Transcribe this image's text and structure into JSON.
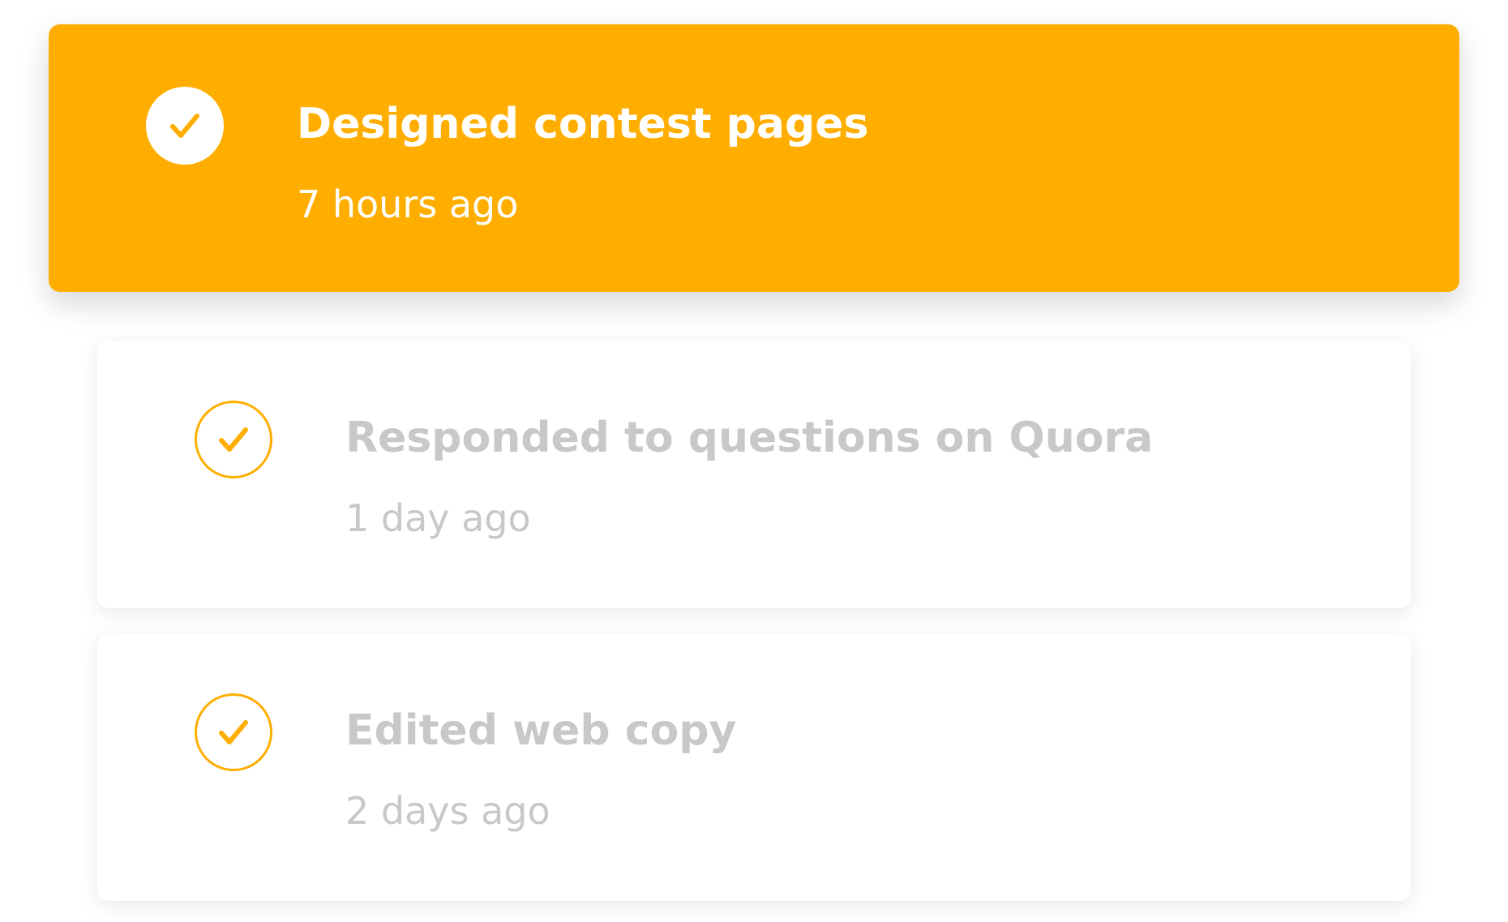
{
  "accent_color": "#FFAE00",
  "muted_text_color": "#C8C8C8",
  "activities": [
    {
      "title": "Designed contest pages",
      "time": "7 hours ago",
      "icon": "check-circle-filled-icon",
      "state": "active"
    },
    {
      "title": "Responded to questions on Quora",
      "time": "1 day ago",
      "icon": "check-circle-outline-icon",
      "state": "inactive"
    },
    {
      "title": "Edited web copy",
      "time": "2 days ago",
      "icon": "check-circle-outline-icon",
      "state": "inactive"
    }
  ]
}
